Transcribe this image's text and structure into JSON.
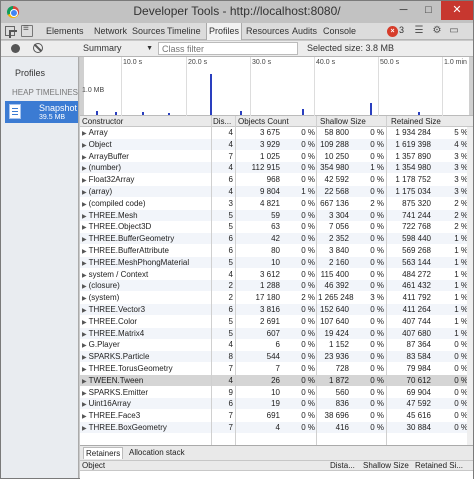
{
  "window": {
    "title": "Developer Tools - http://localhost:8080/",
    "minimize": "─",
    "maximize": "□",
    "close": "✕"
  },
  "tabs": [
    "Elements",
    "Network",
    "Sources",
    "Timeline",
    "Profiles",
    "Resources",
    "Audits",
    "Console"
  ],
  "active_tab": "Profiles",
  "error_count": "3",
  "error_badge": "×",
  "toolbar": {
    "view": "Summary",
    "filter_placeholder": "Class filter",
    "selected_size": "Selected size: 3.8 MB"
  },
  "sidebar": {
    "title": "Profiles",
    "section": "HEAP TIMELINES",
    "snapshot_name": "Snapshot",
    "snapshot_size": "39.5 MB"
  },
  "timeline": {
    "labels": [
      "10.0 s",
      "20.0 s",
      "30.0 s",
      "40.0 s",
      "50.0 s",
      "1.0 min"
    ],
    "mem_label": "1.0 MB"
  },
  "table": {
    "columns": [
      "Constructor",
      "Dis...",
      "Objects Count",
      "Shallow Size",
      "Retained Size"
    ],
    "rows": [
      [
        "Array",
        "4",
        "3 675",
        "0 %",
        "58 800",
        "0 %",
        "1 934 284",
        "5 %"
      ],
      [
        "Object",
        "4",
        "3 929",
        "0 %",
        "109 288",
        "0 %",
        "1 619 398",
        "4 %"
      ],
      [
        "ArrayBuffer",
        "7",
        "1 025",
        "0 %",
        "10 250",
        "0 %",
        "1 357 890",
        "3 %"
      ],
      [
        "(number)",
        "4",
        "112 915",
        "0 %",
        "354 980",
        "1 %",
        "1 354 980",
        "3 %"
      ],
      [
        "Float32Array",
        "6",
        "968",
        "0 %",
        "42 592",
        "0 %",
        "1 178 752",
        "3 %"
      ],
      [
        "(array)",
        "4",
        "9 804",
        "1 %",
        "22 568",
        "0 %",
        "1 175 034",
        "3 %"
      ],
      [
        "(compiled code)",
        "3",
        "4 821",
        "0 %",
        "667 136",
        "2 %",
        "875 320",
        "2 %"
      ],
      [
        "THREE.Mesh",
        "5",
        "59",
        "0 %",
        "3 304",
        "0 %",
        "741 244",
        "2 %"
      ],
      [
        "THREE.Object3D",
        "5",
        "63",
        "0 %",
        "7 056",
        "0 %",
        "722 768",
        "2 %"
      ],
      [
        "THREE.BufferGeometry",
        "6",
        "42",
        "0 %",
        "2 352",
        "0 %",
        "598 440",
        "1 %"
      ],
      [
        "THREE.BufferAttribute",
        "6",
        "80",
        "0 %",
        "3 840",
        "0 %",
        "569 268",
        "1 %"
      ],
      [
        "THREE.MeshPhongMaterial",
        "5",
        "10",
        "0 %",
        "2 160",
        "0 %",
        "563 144",
        "1 %"
      ],
      [
        "system / Context",
        "4",
        "3 612",
        "0 %",
        "115 400",
        "0 %",
        "484 272",
        "1 %"
      ],
      [
        "(closure)",
        "2",
        "1 288",
        "0 %",
        "46 392",
        "0 %",
        "461 432",
        "1 %"
      ],
      [
        "(system)",
        "2",
        "17 180",
        "2 %",
        "1 265 248",
        "3 %",
        "411 792",
        "1 %"
      ],
      [
        "THREE.Vector3",
        "6",
        "3 816",
        "0 %",
        "152 640",
        "0 %",
        "411 264",
        "1 %"
      ],
      [
        "THREE.Color",
        "5",
        "2 691",
        "0 %",
        "107 640",
        "0 %",
        "407 744",
        "1 %"
      ],
      [
        "THREE.Matrix4",
        "5",
        "607",
        "0 %",
        "19 424",
        "0 %",
        "407 680",
        "1 %"
      ],
      [
        "G.Player",
        "4",
        "6",
        "0 %",
        "1 152",
        "0 %",
        "87 364",
        "0 %"
      ],
      [
        "SPARKS.Particle",
        "8",
        "544",
        "0 %",
        "23 936",
        "0 %",
        "83 584",
        "0 %"
      ],
      [
        "THREE.TorusGeometry",
        "7",
        "7",
        "0 %",
        "728",
        "0 %",
        "79 984",
        "0 %"
      ],
      [
        "TWEEN.Tween",
        "4",
        "26",
        "0 %",
        "1 872",
        "0 %",
        "70 612",
        "0 %"
      ],
      [
        "SPARKS.Emitter",
        "9",
        "10",
        "0 %",
        "560",
        "0 %",
        "69 904",
        "0 %"
      ],
      [
        "Uint16Array",
        "6",
        "19",
        "0 %",
        "836",
        "0 %",
        "47 592",
        "0 %"
      ],
      [
        "THREE.Face3",
        "7",
        "691",
        "0 %",
        "38 696",
        "0 %",
        "45 616",
        "0 %"
      ],
      [
        "THREE.BoxGeometry",
        "7",
        "4",
        "0 %",
        "416",
        "0 %",
        "30 884",
        "0 %"
      ]
    ],
    "selected_row": 21
  },
  "retainers": {
    "tabs": [
      "Retainers",
      "Allocation stack"
    ],
    "columns": [
      "Object",
      "Dista...",
      "Shallow Size",
      "Retained Si..."
    ]
  }
}
